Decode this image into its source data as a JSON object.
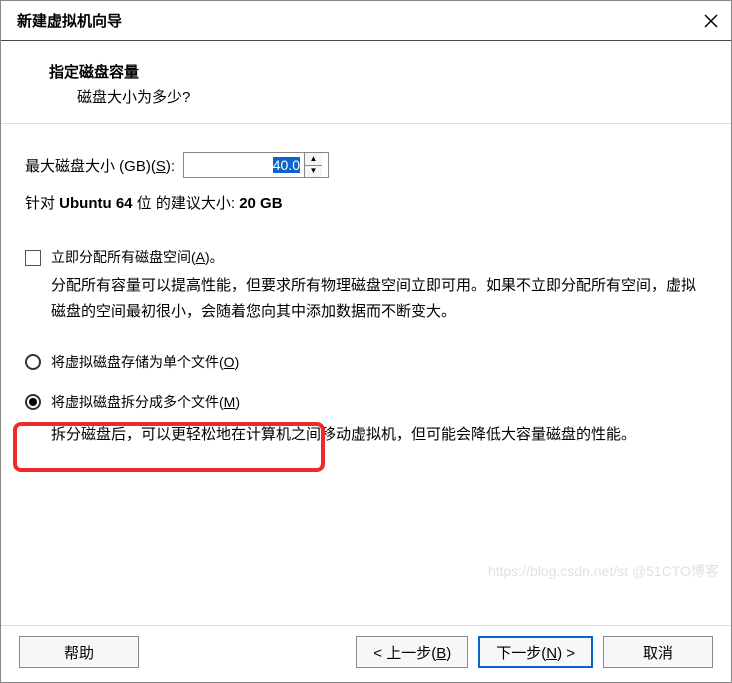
{
  "window": {
    "title": "新建虚拟机向导"
  },
  "header": {
    "title": "指定磁盘容量",
    "subtitle": "磁盘大小为多少?"
  },
  "disk": {
    "label_prefix": "最大磁盘大小 (GB)(",
    "label_key": "S",
    "label_suffix": "):",
    "value": "40.0",
    "recommend_prefix": "针对 ",
    "recommend_os": "Ubuntu 64 ",
    "recommend_mid": "位 的建议大小: ",
    "recommend_size": "20 GB"
  },
  "allocate": {
    "label_prefix": "立即分配所有磁盘空间(",
    "label_key": "A",
    "label_suffix": ")。",
    "desc": "分配所有容量可以提高性能，但要求所有物理磁盘空间立即可用。如果不立即分配所有空间，虚拟磁盘的空间最初很小，会随着您向其中添加数据而不断变大。"
  },
  "store": {
    "single_prefix": "将虚拟磁盘存储为单个文件(",
    "single_key": "O",
    "single_suffix": ")",
    "multi_prefix": "将虚拟磁盘拆分成多个文件(",
    "multi_key": "M",
    "multi_suffix": ")",
    "multi_desc": "拆分磁盘后，可以更轻松地在计算机之间移动虚拟机，但可能会降低大容量磁盘的性能。"
  },
  "buttons": {
    "help": "帮助",
    "back_prefix": "< 上一步(",
    "back_key": "B",
    "back_suffix": ")",
    "next_prefix": "下一步(",
    "next_key": "N",
    "next_suffix": ") >",
    "cancel": "取消"
  },
  "watermark": "https://blog.csdn.net/st  @51CTO博客"
}
